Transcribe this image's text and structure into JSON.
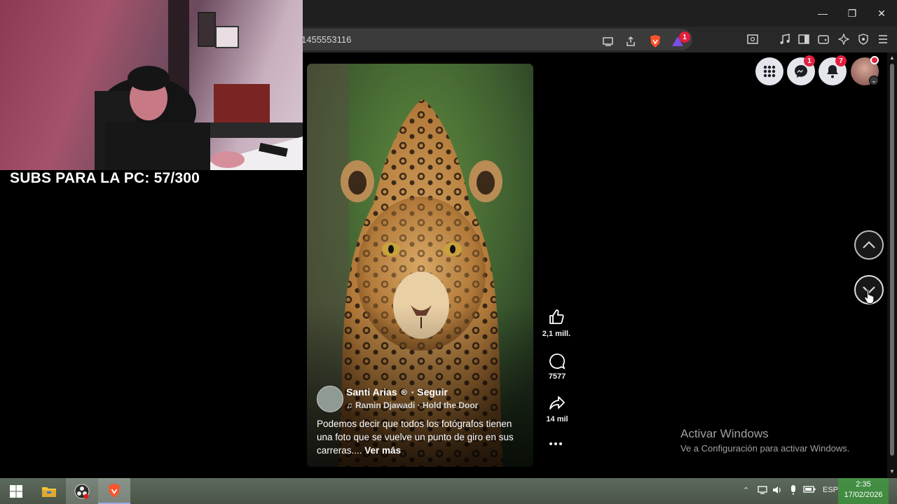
{
  "overlay": {
    "subs_text": "SUBS PARA LA PC: 57/300"
  },
  "browser": {
    "url_fragment": "1455553116",
    "window_controls": {
      "minimize": "—",
      "restore": "❐",
      "close": "✕"
    },
    "shields_badge": "1"
  },
  "header": {
    "messenger_badge": "1",
    "notifications_badge": "7"
  },
  "reel": {
    "author": "Santi Arias",
    "follow": "· Seguir",
    "music": "Ramin Djawadi · Hold the Door",
    "caption": "Podemos decir que todos los fotógrafos tienen una foto que se vuelve un punto de giro en sus carreras....",
    "see_more": "Ver más"
  },
  "actions": {
    "likes": "2,1 mill.",
    "comments": "7577",
    "shares": "14 mil"
  },
  "watermark": {
    "title": "Activar Windows",
    "subtitle": "Ve a Configuración para activar Windows."
  },
  "taskbar": {
    "language": "ESP",
    "time": "2:35",
    "date": "17/02/2026"
  },
  "colors": {
    "badge": "#e41e3f",
    "background": "#000000",
    "chrome": "#282828"
  }
}
